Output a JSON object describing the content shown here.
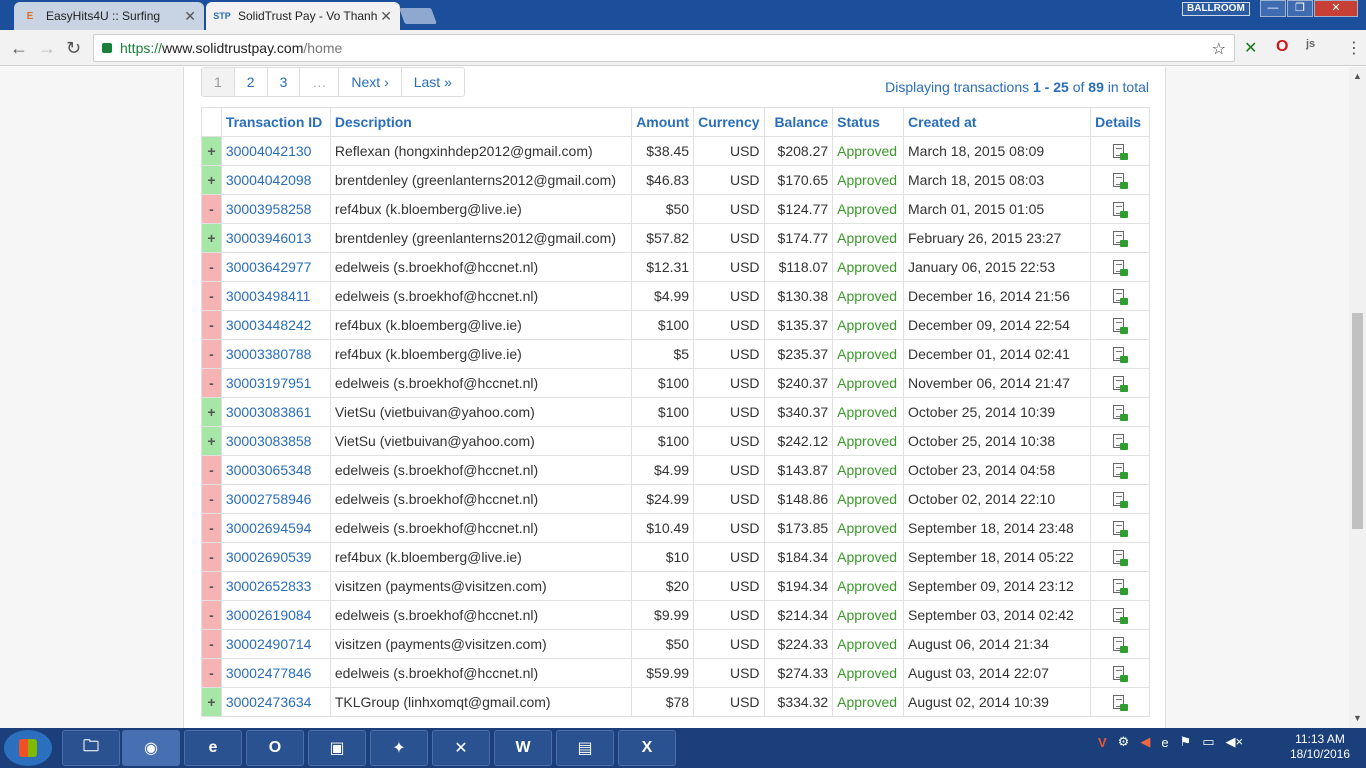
{
  "browser": {
    "tabs": [
      {
        "favicon": "E",
        "title": "EasyHits4U :: Surfing"
      },
      {
        "favicon": "STP",
        "title": "SolidTrust Pay - Vo Thanh"
      }
    ],
    "profile": "BALLROOM",
    "url": {
      "scheme": "https://",
      "host": "www.solidtrustpay.com",
      "path": "/home"
    }
  },
  "pagination": {
    "pages": [
      "1",
      "2",
      "3",
      "…"
    ],
    "next": "Next ›",
    "last": "Last »"
  },
  "summary": {
    "prefix": "Displaying transactions",
    "range": "1 - 25",
    "of": "of",
    "total": "89",
    "suffix": "in total"
  },
  "table": {
    "headers": {
      "txid": "Transaction ID",
      "description": "Description",
      "amount": "Amount",
      "currency": "Currency",
      "balance": "Balance",
      "status": "Status",
      "created": "Created at",
      "details": "Details"
    },
    "rows": [
      {
        "sign": "+",
        "type": "credit",
        "txid": "30004042130",
        "description": "Reflexan (hongxinhdep2012@gmail.com)",
        "amount": "$38.45",
        "currency": "USD",
        "balance": "$208.27",
        "status": "Approved",
        "created": "March 18, 2015 08:09"
      },
      {
        "sign": "+",
        "type": "credit",
        "txid": "30004042098",
        "description": "brentdenley (greenlanterns2012@gmail.com)",
        "amount": "$46.83",
        "currency": "USD",
        "balance": "$170.65",
        "status": "Approved",
        "created": "March 18, 2015 08:03"
      },
      {
        "sign": "-",
        "type": "debit",
        "txid": "30003958258",
        "description": "ref4bux (k.bloemberg@live.ie)",
        "amount": "$50",
        "currency": "USD",
        "balance": "$124.77",
        "status": "Approved",
        "created": "March 01, 2015 01:05"
      },
      {
        "sign": "+",
        "type": "credit",
        "txid": "30003946013",
        "description": "brentdenley (greenlanterns2012@gmail.com)",
        "amount": "$57.82",
        "currency": "USD",
        "balance": "$174.77",
        "status": "Approved",
        "created": "February 26, 2015 23:27"
      },
      {
        "sign": "-",
        "type": "debit",
        "txid": "30003642977",
        "description": "edelweis (s.broekhof@hccnet.nl)",
        "amount": "$12.31",
        "currency": "USD",
        "balance": "$118.07",
        "status": "Approved",
        "created": "January 06, 2015 22:53"
      },
      {
        "sign": "-",
        "type": "debit",
        "txid": "30003498411",
        "description": "edelweis (s.broekhof@hccnet.nl)",
        "amount": "$4.99",
        "currency": "USD",
        "balance": "$130.38",
        "status": "Approved",
        "created": "December 16, 2014 21:56"
      },
      {
        "sign": "-",
        "type": "debit",
        "txid": "30003448242",
        "description": "ref4bux (k.bloemberg@live.ie)",
        "amount": "$100",
        "currency": "USD",
        "balance": "$135.37",
        "status": "Approved",
        "created": "December 09, 2014 22:54"
      },
      {
        "sign": "-",
        "type": "debit",
        "txid": "30003380788",
        "description": "ref4bux (k.bloemberg@live.ie)",
        "amount": "$5",
        "currency": "USD",
        "balance": "$235.37",
        "status": "Approved",
        "created": "December 01, 2014 02:41"
      },
      {
        "sign": "-",
        "type": "debit",
        "txid": "30003197951",
        "description": "edelweis (s.broekhof@hccnet.nl)",
        "amount": "$100",
        "currency": "USD",
        "balance": "$240.37",
        "status": "Approved",
        "created": "November 06, 2014 21:47"
      },
      {
        "sign": "+",
        "type": "credit",
        "txid": "30003083861",
        "description": "VietSu (vietbuivan@yahoo.com)",
        "amount": "$100",
        "currency": "USD",
        "balance": "$340.37",
        "status": "Approved",
        "created": "October 25, 2014 10:39"
      },
      {
        "sign": "+",
        "type": "credit",
        "txid": "30003083858",
        "description": "VietSu (vietbuivan@yahoo.com)",
        "amount": "$100",
        "currency": "USD",
        "balance": "$242.12",
        "status": "Approved",
        "created": "October 25, 2014 10:38"
      },
      {
        "sign": "-",
        "type": "debit",
        "txid": "30003065348",
        "description": "edelweis (s.broekhof@hccnet.nl)",
        "amount": "$4.99",
        "currency": "USD",
        "balance": "$143.87",
        "status": "Approved",
        "created": "October 23, 2014 04:58"
      },
      {
        "sign": "-",
        "type": "debit",
        "txid": "30002758946",
        "description": "edelweis (s.broekhof@hccnet.nl)",
        "amount": "$24.99",
        "currency": "USD",
        "balance": "$148.86",
        "status": "Approved",
        "created": "October 02, 2014 22:10"
      },
      {
        "sign": "-",
        "type": "debit",
        "txid": "30002694594",
        "description": "edelweis (s.broekhof@hccnet.nl)",
        "amount": "$10.49",
        "currency": "USD",
        "balance": "$173.85",
        "status": "Approved",
        "created": "September 18, 2014 23:48"
      },
      {
        "sign": "-",
        "type": "debit",
        "txid": "30002690539",
        "description": "ref4bux (k.bloemberg@live.ie)",
        "amount": "$10",
        "currency": "USD",
        "balance": "$184.34",
        "status": "Approved",
        "created": "September 18, 2014 05:22"
      },
      {
        "sign": "-",
        "type": "debit",
        "txid": "30002652833",
        "description": "visitzen (payments@visitzen.com)",
        "amount": "$20",
        "currency": "USD",
        "balance": "$194.34",
        "status": "Approved",
        "created": "September 09, 2014 23:12"
      },
      {
        "sign": "-",
        "type": "debit",
        "txid": "30002619084",
        "description": "edelweis (s.broekhof@hccnet.nl)",
        "amount": "$9.99",
        "currency": "USD",
        "balance": "$214.34",
        "status": "Approved",
        "created": "September 03, 2014 02:42"
      },
      {
        "sign": "-",
        "type": "debit",
        "txid": "30002490714",
        "description": "visitzen (payments@visitzen.com)",
        "amount": "$50",
        "currency": "USD",
        "balance": "$224.33",
        "status": "Approved",
        "created": "August 06, 2014 21:34"
      },
      {
        "sign": "-",
        "type": "debit",
        "txid": "30002477846",
        "description": "edelweis (s.broekhof@hccnet.nl)",
        "amount": "$59.99",
        "currency": "USD",
        "balance": "$274.33",
        "status": "Approved",
        "created": "August 03, 2014 22:07"
      },
      {
        "sign": "+",
        "type": "credit",
        "txid": "30002473634",
        "description": "TKLGroup (linhxomqt@gmail.com)",
        "amount": "$78",
        "currency": "USD",
        "balance": "$334.32",
        "status": "Approved",
        "created": "August 02, 2014 10:39"
      }
    ]
  },
  "taskbar": {
    "apps": [
      {
        "name": "explorer",
        "glyph": "🗀"
      },
      {
        "name": "chrome",
        "glyph": "◉"
      },
      {
        "name": "ie",
        "glyph": "e"
      },
      {
        "name": "outlook",
        "glyph": "O"
      },
      {
        "name": "control-panel",
        "glyph": "▣"
      },
      {
        "name": "network",
        "glyph": "✦"
      },
      {
        "name": "xampp",
        "glyph": "✕"
      },
      {
        "name": "word",
        "glyph": "W"
      },
      {
        "name": "viewer",
        "glyph": "▤"
      },
      {
        "name": "excel",
        "glyph": "X"
      }
    ],
    "time": "11:13 AM",
    "date": "18/10/2016"
  },
  "colors": {
    "link": "#2a6ebb",
    "credit": "#a6e6a6",
    "debit": "#f5b3b3",
    "approved": "#3a9a2a",
    "tabstrip": "#1b4f9c",
    "taskbar": "#1a3f7a"
  }
}
